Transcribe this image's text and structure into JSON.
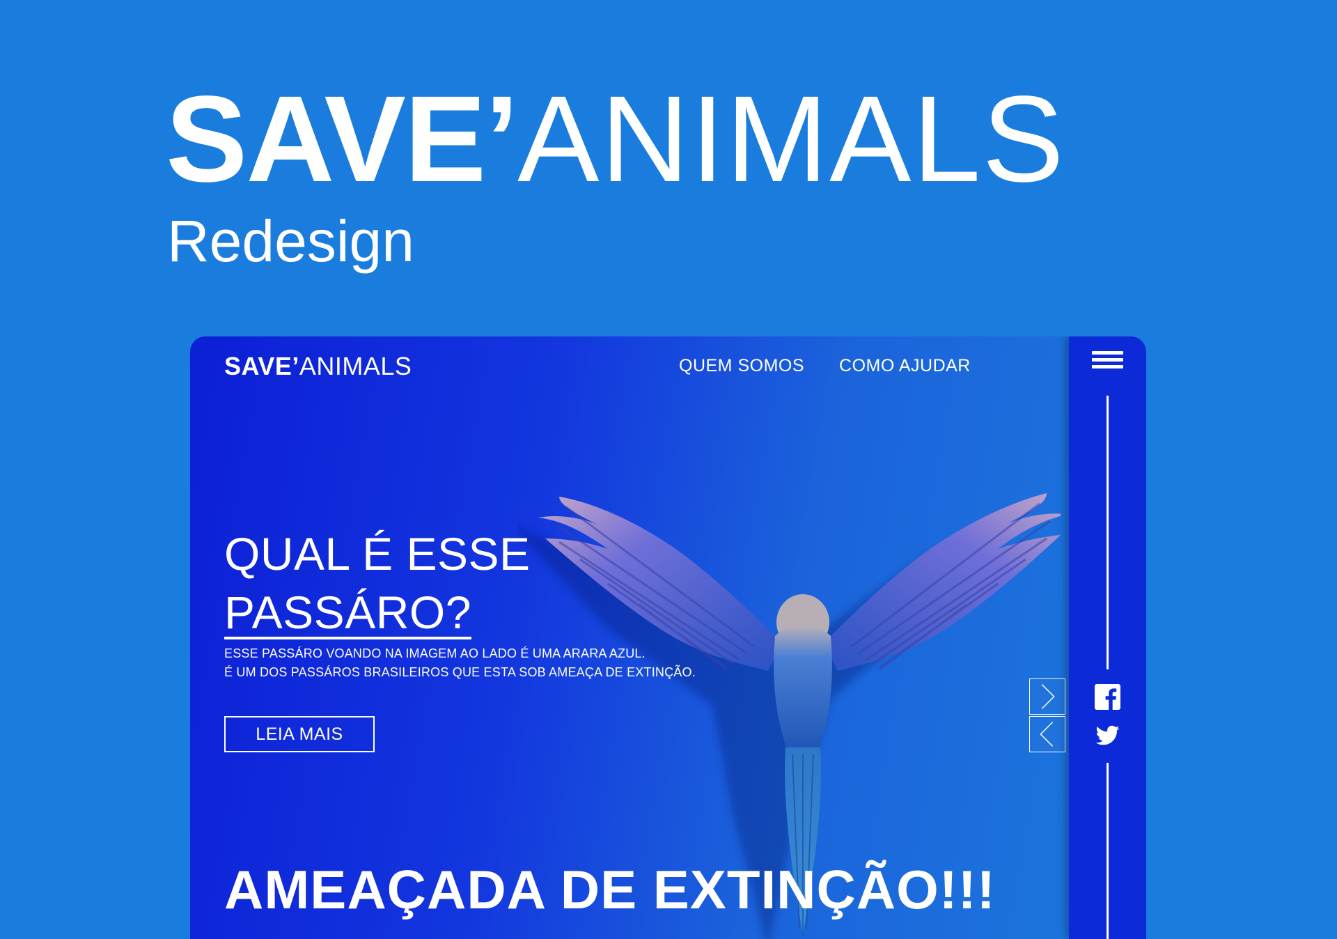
{
  "presentation": {
    "title_bold": "SAVE’",
    "title_light": "ANIMALS",
    "subtitle": "Redesign"
  },
  "site": {
    "logo_bold": "SAVE’",
    "logo_light": "ANIMALS",
    "nav": [
      {
        "label": "QUEM SOMOS"
      },
      {
        "label": "COMO AJUDAR"
      }
    ],
    "hero": {
      "heading_line1": "QUAL É ESSE",
      "heading_line2": "PASSÁRO?",
      "text_line1": "ESSE PASSÁRO VOANDO NA IMAGEM AO LADO É UMA ARARA AZUL.",
      "text_line2": "É UM DOS PASSÁROS BRASILEIROS QUE ESTA SOB AMEAÇA DE EXTINÇÃO.",
      "button_label": "LEIA MAIS"
    },
    "banner": "AMEAÇADA DE EXTINÇÃO!!!",
    "icons": {
      "menu": "hamburger-menu-icon",
      "next": "chevron-right-icon",
      "prev": "chevron-left-icon",
      "facebook": "facebook-icon",
      "twitter": "twitter-icon"
    }
  },
  "colors": {
    "page_background": "#1a7ddd",
    "hero_deep_blue": "#0c1fd6",
    "sidebar_blue": "#0c2ad8",
    "text": "#ffffff",
    "macaw_blue": "#2f6fd0"
  }
}
